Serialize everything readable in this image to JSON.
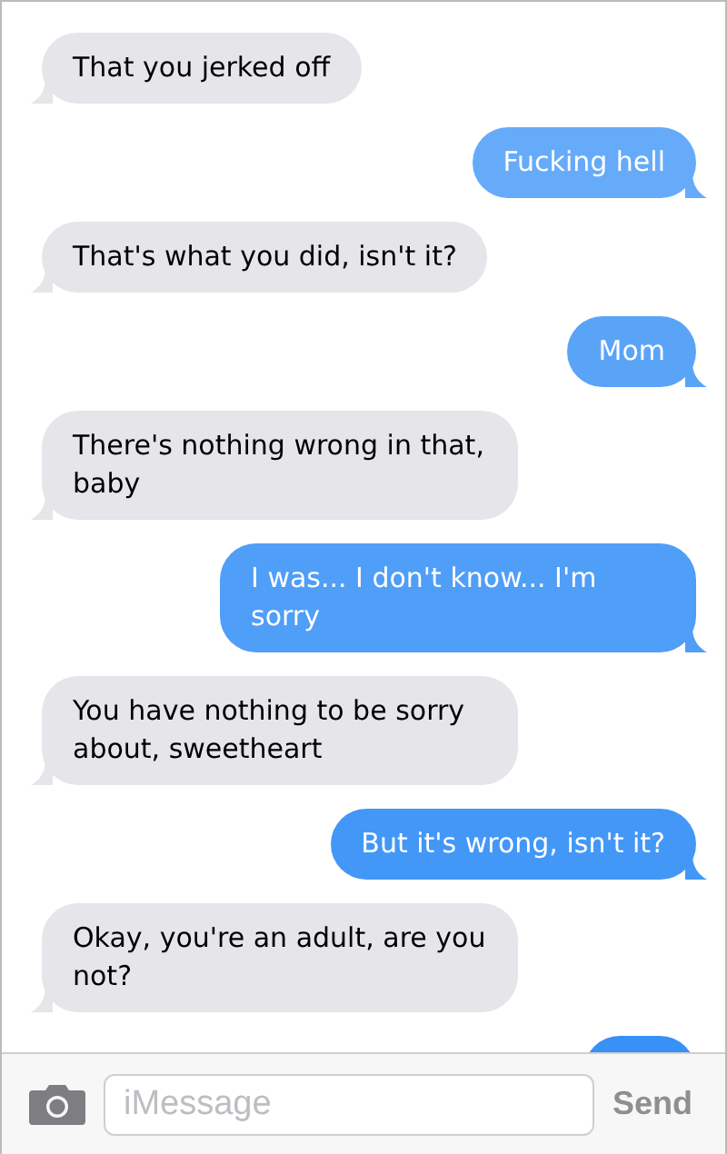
{
  "messages": [
    {
      "kind": "incoming",
      "text": "That you jerked off"
    },
    {
      "kind": "outgoing",
      "text": "Fucking hell"
    },
    {
      "kind": "incoming",
      "text": "That's what you did, isn't it?"
    },
    {
      "kind": "outgoing",
      "text": "Mom"
    },
    {
      "kind": "incoming",
      "text": "There's nothing wrong in that, baby"
    },
    {
      "kind": "outgoing",
      "text": "I was... I don't know... I'm sorry"
    },
    {
      "kind": "incoming",
      "text": "You have nothing to be sorry about, sweetheart"
    },
    {
      "kind": "outgoing",
      "text": "But it's wrong, isn't it?"
    },
    {
      "kind": "incoming",
      "text": "Okay, you're an adult, are you not?"
    },
    {
      "kind": "outgoing"
    }
  ],
  "composer": {
    "placeholder": "iMessage",
    "send": "Send"
  }
}
